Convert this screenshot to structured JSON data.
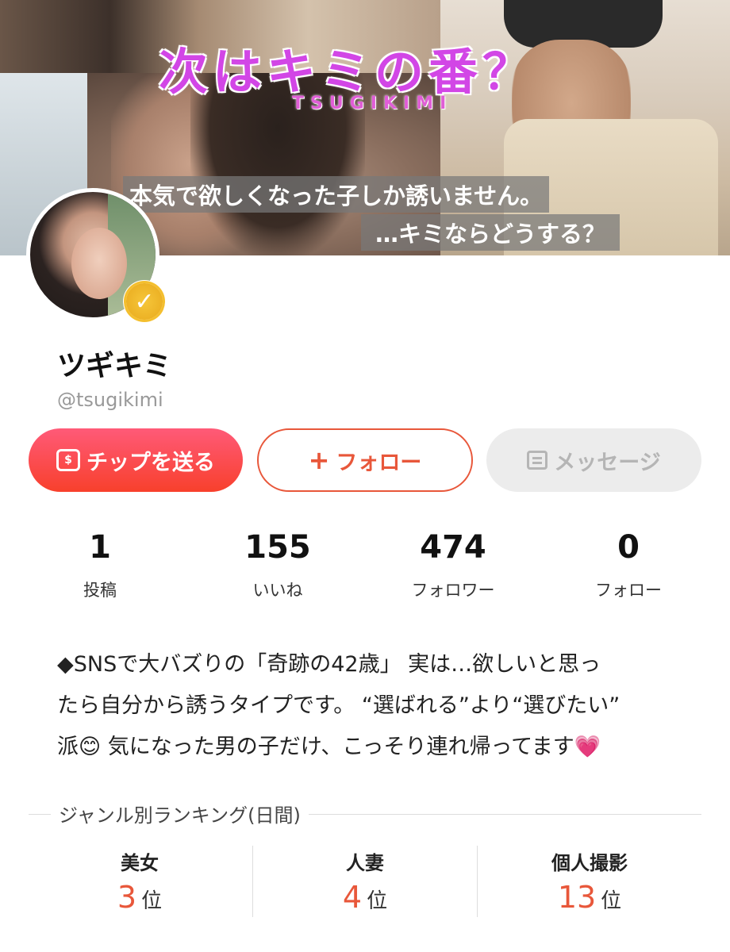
{
  "banner": {
    "title": "次はキミの番？",
    "subtitle": "TSUGIKIMI",
    "caption1": "本気で欲しくなった子しか誘いません。",
    "caption2": "…キミならどうする？"
  },
  "profile": {
    "name": "ツギキミ",
    "handle": "@tsugikimi",
    "verified": true,
    "verified_color": "#f0b429"
  },
  "actions": {
    "tip_label": "チップを送る",
    "tip_icon_glyph": "$",
    "follow_label": "フォロー",
    "follow_icon_glyph": "+",
    "message_label": "メッセージ"
  },
  "stats": [
    {
      "value": "1",
      "label": "投稿"
    },
    {
      "value": "155",
      "label": "いいね"
    },
    {
      "value": "474",
      "label": "フォロワー"
    },
    {
      "value": "0",
      "label": "フォロー"
    }
  ],
  "bio": {
    "lines": [
      "◆SNSで大バズりの「奇跡の42歳」 実は…欲しいと思っ",
      "たら自分から誘うタイプです。 “選ばれる”より“選びたい”",
      "派😊 気になった男の子だけ、こっそり連れ帰ってます💗"
    ]
  },
  "ranking": {
    "heading": "ジャンル別ランキング(日間)",
    "unit": "位",
    "items": [
      {
        "category": "美女",
        "rank": "3"
      },
      {
        "category": "人妻",
        "rank": "4"
      },
      {
        "category": "個人撮影",
        "rank": "13"
      }
    ]
  },
  "colors": {
    "accent": "#e8573a",
    "tip_gradient_start": "#ff5a78",
    "tip_gradient_end": "#f8402c",
    "banner_title": "#d246e6"
  }
}
